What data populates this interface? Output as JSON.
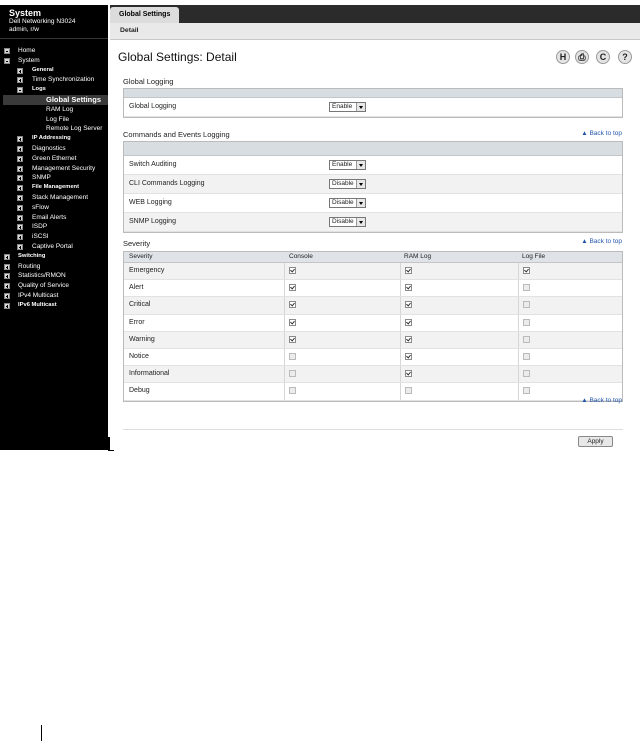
{
  "sidebar": {
    "title": "System",
    "model": "Dell Networking N3024",
    "user": "admin, r/w",
    "tree": [
      {
        "label": "Home",
        "level": 0,
        "box": "minus"
      },
      {
        "label": "System",
        "level": 0,
        "box": "minus"
      },
      {
        "label": "General",
        "level": 1,
        "box": "plus",
        "small": true
      },
      {
        "label": "Time Synchronization",
        "level": 1,
        "box": "plus"
      },
      {
        "label": "Logs",
        "level": 1,
        "box": "minus",
        "small": true
      },
      {
        "label": "Global Settings",
        "level": 2,
        "box": "",
        "selected": true
      },
      {
        "label": "RAM Log",
        "level": 2,
        "box": ""
      },
      {
        "label": "Log File",
        "level": 2,
        "box": ""
      },
      {
        "label": "Remote Log Server",
        "level": 2,
        "box": ""
      },
      {
        "label": "IP Addressing",
        "level": 1,
        "box": "plus",
        "small": true
      },
      {
        "label": "Diagnostics",
        "level": 1,
        "box": "plus"
      },
      {
        "label": "Green Ethernet",
        "level": 1,
        "box": "plus"
      },
      {
        "label": "Management Security",
        "level": 1,
        "box": "plus"
      },
      {
        "label": "SNMP",
        "level": 1,
        "box": "plus"
      },
      {
        "label": "File Management",
        "level": 1,
        "box": "plus",
        "small": true
      },
      {
        "label": "Stack Management",
        "level": 1,
        "box": "plus"
      },
      {
        "label": "sFlow",
        "level": 1,
        "box": "plus"
      },
      {
        "label": "Email Alerts",
        "level": 1,
        "box": "plus"
      },
      {
        "label": "ISDP",
        "level": 1,
        "box": "plus"
      },
      {
        "label": "iSCSI",
        "level": 1,
        "box": "plus"
      },
      {
        "label": "Captive Portal",
        "level": 1,
        "box": "plus"
      },
      {
        "label": "Switching",
        "level": 0,
        "box": "plus",
        "small": true
      },
      {
        "label": "Routing",
        "level": 0,
        "box": "plus"
      },
      {
        "label": "Statistics/RMON",
        "level": 0,
        "box": "plus"
      },
      {
        "label": "Quality of Service",
        "level": 0,
        "box": "plus"
      },
      {
        "label": "IPv4 Multicast",
        "level": 0,
        "box": "plus"
      },
      {
        "label": "IPv6 Multicast",
        "level": 0,
        "box": "plus",
        "small": true
      }
    ]
  },
  "tabs": {
    "active": "Global Settings",
    "sub": "Detail"
  },
  "page_title": "Global Settings: Detail",
  "toolbar": {
    "save_icon": "H",
    "print_icon": "⎙",
    "refresh_icon": "C",
    "help_icon": "?"
  },
  "global_logging": {
    "section_title": "Global Logging",
    "rows": [
      {
        "label": "Global Logging",
        "value": "Enable"
      }
    ]
  },
  "commands_events": {
    "section_title": "Commands and Events Logging",
    "back_to_top": "Back to top",
    "rows": [
      {
        "label": "Switch Auditing",
        "value": "Enable"
      },
      {
        "label": "CLI Commands Logging",
        "value": "Disable"
      },
      {
        "label": "WEB Logging",
        "value": "Disable"
      },
      {
        "label": "SNMP Logging",
        "value": "Disable"
      }
    ]
  },
  "severity": {
    "section_title": "Severity",
    "back_to_top": "Back to top",
    "headers": [
      "Severity",
      "Console",
      "RAM Log",
      "Log File"
    ],
    "rows": [
      {
        "name": "Emergency",
        "console": true,
        "ram": true,
        "file": true
      },
      {
        "name": "Alert",
        "console": true,
        "ram": true,
        "file": false
      },
      {
        "name": "Critical",
        "console": true,
        "ram": true,
        "file": false
      },
      {
        "name": "Error",
        "console": true,
        "ram": true,
        "file": false
      },
      {
        "name": "Warning",
        "console": true,
        "ram": true,
        "file": false
      },
      {
        "name": "Notice",
        "console": false,
        "ram": true,
        "file": false
      },
      {
        "name": "Informational",
        "console": false,
        "ram": true,
        "file": false
      },
      {
        "name": "Debug",
        "console": false,
        "ram": false,
        "file": false
      }
    ],
    "back_to_top_bottom": "Back to top"
  },
  "apply_label": "Apply"
}
